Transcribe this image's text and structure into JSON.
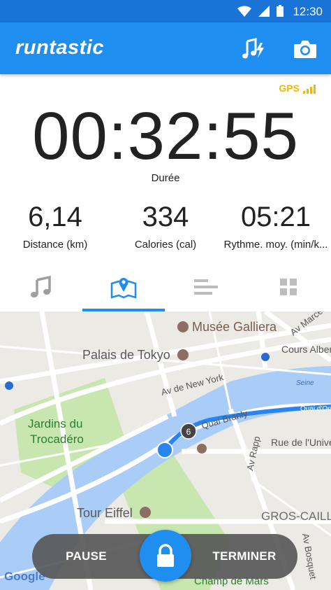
{
  "status_bar": {
    "time": "12:30"
  },
  "app": {
    "logo": "runtastic"
  },
  "gps": {
    "label": "GPS"
  },
  "timer": {
    "value": "00:32:55",
    "label": "Durée"
  },
  "stats": [
    {
      "value": "6,14",
      "label": "Distance (km)"
    },
    {
      "value": "334",
      "label": "Calories (cal)"
    },
    {
      "value": "05:21",
      "label": "Rythme. moy. (min/k..."
    }
  ],
  "tabs": [
    {
      "icon": "music-icon",
      "active": false
    },
    {
      "icon": "map-icon",
      "active": true
    },
    {
      "icon": "list-icon",
      "active": false
    },
    {
      "icon": "grid-icon",
      "active": false
    }
  ],
  "map": {
    "labels": {
      "musee_galliera": "Musée Galliera",
      "palais_de_tokyo": "Palais de Tokyo",
      "av_de_new_york": "Av de New York",
      "jardins": "Jardins du",
      "trocadero": "Trocadéro",
      "quai_branly": "Quai Branly",
      "rue_universite": "Rue de l'Unive",
      "av_rapp": "Av Rapp",
      "tour_eiffel": "Tour Eiffel",
      "gros_caillou": "GROS-CAILLO",
      "seine": "Seine",
      "cours_albert": "Cours Alber",
      "av_marceau": "Av Marce",
      "quai_orsay": "Quai d'Orsay",
      "av_bosquet": "Av Bosquet",
      "champ_de_mars": "Champ de Mars",
      "google": "Google"
    },
    "marker_number": "6",
    "colors": {
      "water": "#a9cdf7",
      "park": "#c8e6b0",
      "route": "#2a84f0"
    }
  },
  "controls": {
    "pause": "PAUSE",
    "finish": "TERMINER"
  },
  "colors": {
    "brand": "#1f8ef1",
    "status_bar": "#1a73d6",
    "gps": "#f2b705"
  }
}
